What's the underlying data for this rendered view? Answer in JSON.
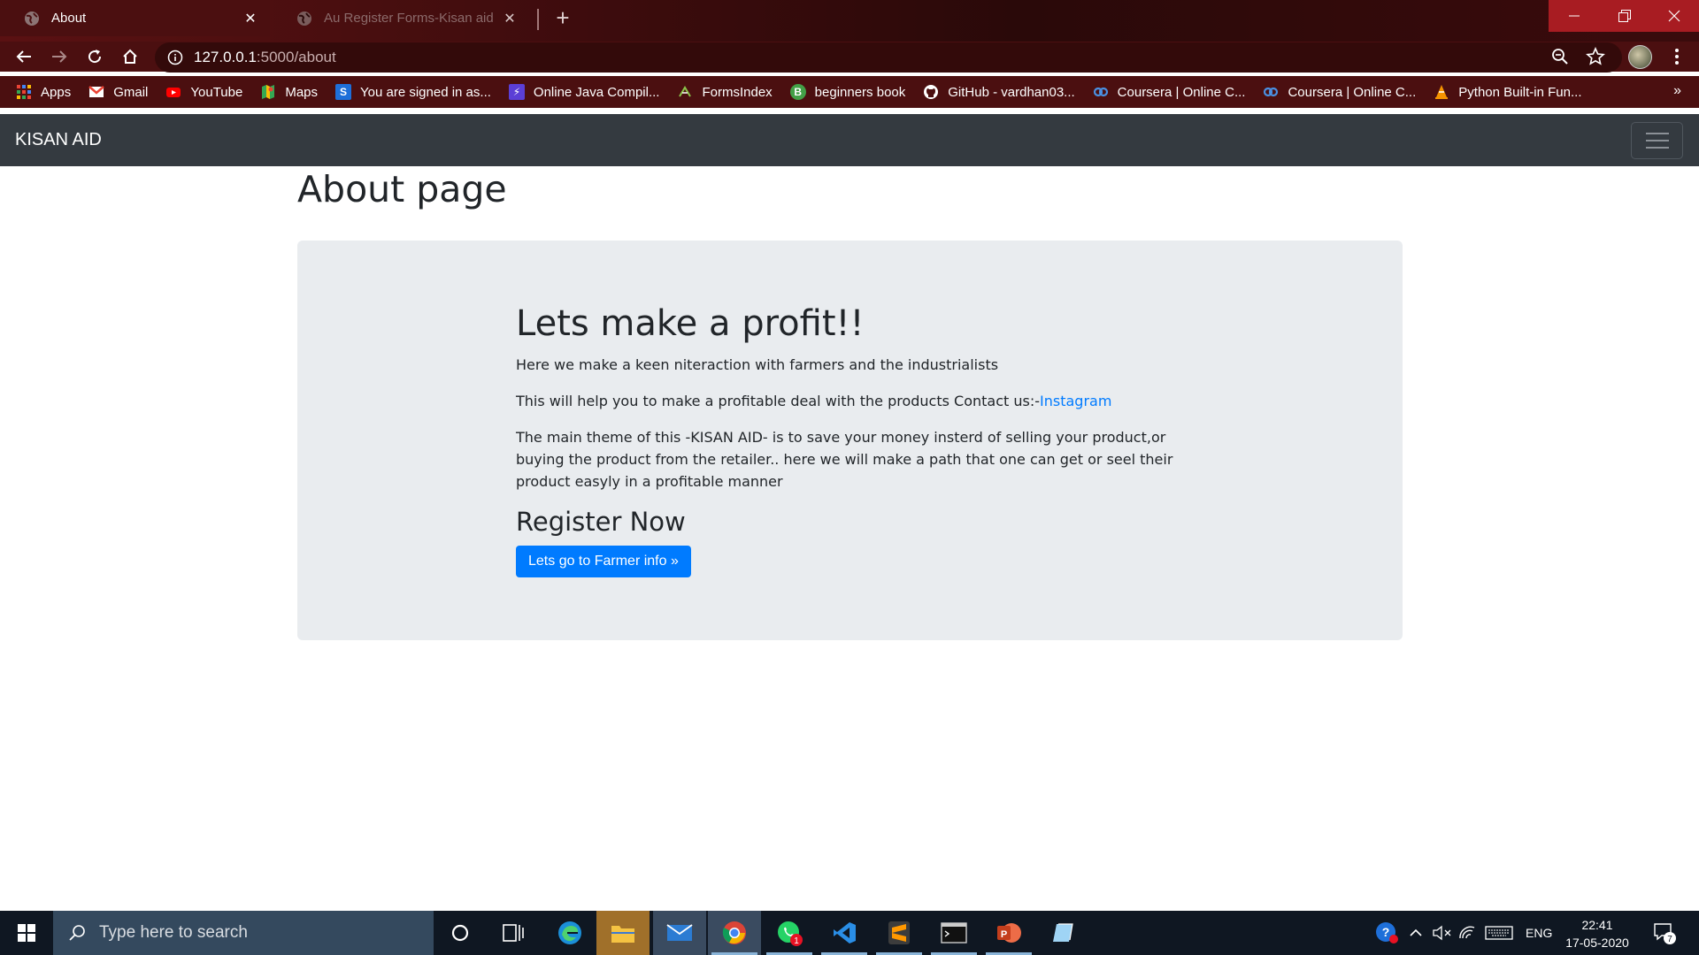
{
  "browser": {
    "tabs": [
      {
        "title": "About",
        "active": true
      },
      {
        "title": "Au Register Forms-Kisan aid",
        "active": false
      }
    ],
    "url_host": "127.0.0.1",
    "url_path": ":5000/about",
    "bookmarks": [
      {
        "label": "Apps",
        "icon": "apps-grid-icon",
        "color": "#ea4335"
      },
      {
        "label": "Gmail",
        "icon": "gmail-icon",
        "color": "#ea4335"
      },
      {
        "label": "YouTube",
        "icon": "youtube-icon",
        "color": "#ff0000"
      },
      {
        "label": "Maps",
        "icon": "maps-icon",
        "color": "#34a853"
      },
      {
        "label": "You are signed in as...",
        "icon": "s-icon",
        "color": "#1e6fd9"
      },
      {
        "label": "Online Java Compil...",
        "icon": "bolt-icon",
        "color": "#5b3fd6"
      },
      {
        "label": "FormsIndex",
        "icon": "forms-icon",
        "color": "#2e7d32"
      },
      {
        "label": "beginners book",
        "icon": "b-icon",
        "color": "#43a047"
      },
      {
        "label": "GitHub - vardhan03...",
        "icon": "github-icon",
        "color": "#ffffff"
      },
      {
        "label": "Coursera | Online C...",
        "icon": "coursera-icon",
        "color": "#2a73cc"
      },
      {
        "label": "Coursera | Online C...",
        "icon": "coursera-icon",
        "color": "#2a73cc"
      },
      {
        "label": "Python Built-in Fun...",
        "icon": "cone-icon",
        "color": "#f59300"
      }
    ],
    "more_bookmarks": "»"
  },
  "navbar": {
    "brand": "KISAN AID"
  },
  "page": {
    "title": "About page",
    "jumbotron": {
      "heading": "Lets make a profit!!",
      "p1": "Here we make a keen niteraction with farmers and the industrialists",
      "p2_text": "This will help you to make a profitable deal with the products Contact us:-",
      "p2_link": "Instagram",
      "p3": "The main theme of this -KISAN AID- is to save your money insterd of selling your product,or buying the product from the retailer.. here we will make a path that one can get or seel their product easyly in a profitable manner",
      "subheading": "Register Now",
      "button": "Lets go to Farmer info »"
    }
  },
  "taskbar": {
    "search_placeholder": "Type here to search",
    "language": "ENG",
    "time": "22:41",
    "date": "17-05-2020",
    "notification_count": "7",
    "whatsapp_badge": "1"
  },
  "colors": {
    "navbar_bg": "#343a40",
    "jumbotron_bg": "#e9ecef",
    "primary": "#007bff",
    "chrome_bg": "#4b0f10"
  }
}
